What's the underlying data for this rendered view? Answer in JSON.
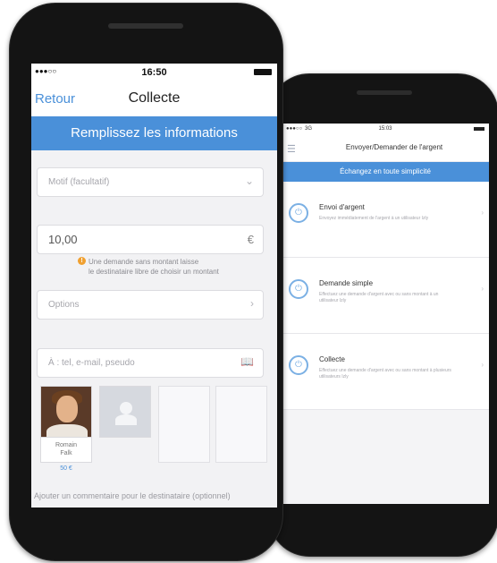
{
  "front": {
    "status": {
      "signal": "●●●○○",
      "time": "16:50"
    },
    "nav": {
      "back_label": "Retour",
      "title": "Collecte"
    },
    "banner": "Remplissez les informations",
    "motif": {
      "placeholder": "Motif (facultatif)"
    },
    "amount": {
      "value": "10,00",
      "currency": "€"
    },
    "hint": {
      "line1": "Une demande sans montant laisse",
      "line2": "le destinataire libre de choisir un montant"
    },
    "options_label": "Options",
    "destinataire_placeholder": "À : tel, e-mail, pseudo",
    "contacts": [
      {
        "name_line1": "Romain",
        "name_line2": "Falk",
        "amount": "50 €"
      }
    ],
    "comment_placeholder": "Ajouter un commentaire pour le destinataire (optionnel)"
  },
  "back": {
    "status": {
      "carrier": "●●●○○",
      "network": "3G",
      "time": "15:03"
    },
    "nav": {
      "title": "Envoyer/Demander de l'argent"
    },
    "banner": "Échangez en toute simplicité",
    "items": [
      {
        "title": "Envoi d'argent",
        "desc": "Envoyez immédiatement de l'argent à un utilisateur Izly"
      },
      {
        "title": "Demande simple",
        "desc": "Effectuez une demande d'argent avec ou sans montant à un utilisateur Izly"
      },
      {
        "title": "Collecte",
        "desc": "Effectuez une demande d'argent avec ou sans montant à plusieurs utilisateurs Izly"
      }
    ]
  },
  "icons": {
    "chevron": "›",
    "dropdown": "⌄",
    "contacts_book": "📖",
    "info": "!",
    "menu": "☰",
    "item_icon": "⏻"
  },
  "colors": {
    "accent": "#4a90d9",
    "phone_body": "#141414",
    "hint_icon": "#f0a030"
  }
}
